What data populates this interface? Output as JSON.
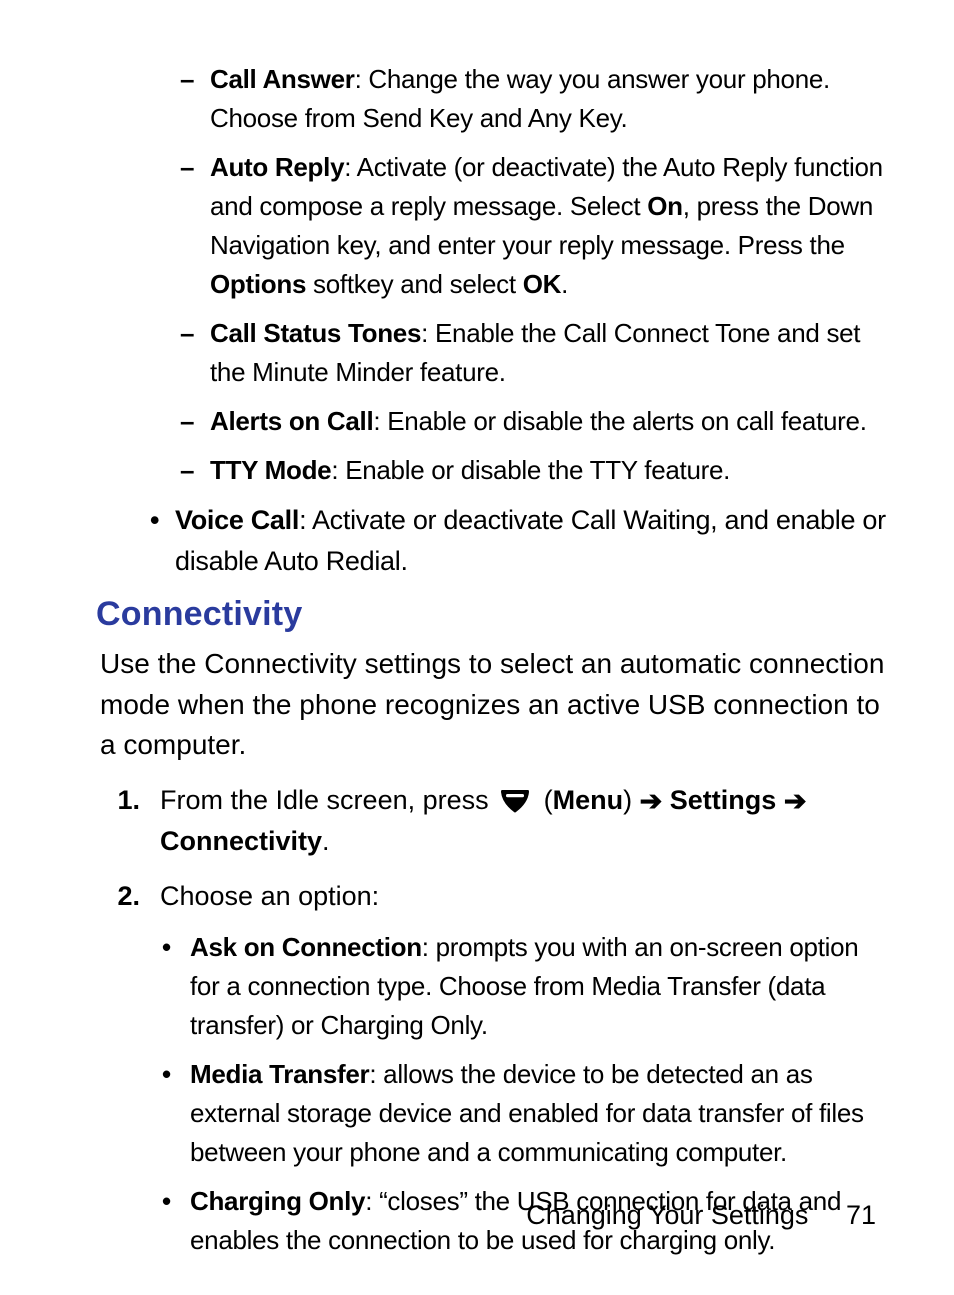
{
  "dashItems": [
    {
      "label": "Call Answer",
      "rest": ": Change the way you answer your phone. Choose from Send Key and Any Key."
    },
    {
      "label": "Auto Reply",
      "segments": [
        {
          "t": ": Activate (or deactivate) the Auto Reply function and compose a reply message. Select "
        },
        {
          "t": "On",
          "b": true
        },
        {
          "t": ", press the Down Navigation key, and enter your reply message. Press the "
        },
        {
          "t": "Options",
          "b": true
        },
        {
          "t": " softkey and select "
        },
        {
          "t": "OK",
          "b": true
        },
        {
          "t": "."
        }
      ]
    },
    {
      "label": "Call Status Tones",
      "rest": ": Enable the Call Connect Tone and set the Minute Minder feature."
    },
    {
      "label": "Alerts on Call",
      "rest": ": Enable or disable the alerts on call feature."
    },
    {
      "label": "TTY Mode",
      "rest": ": Enable or disable the TTY feature."
    }
  ],
  "voiceCall": {
    "label": "Voice Call",
    "rest": ": Activate or deactivate Call Waiting, and enable or disable Auto Redial."
  },
  "heading": "Connectivity",
  "intro": "Use the Connectivity settings to select an automatic connection mode when the phone recognizes an active USB connection to a computer.",
  "step1_pre": "From the Idle screen, press ",
  "step1_post_open": " (",
  "step1_menuWord": "Menu",
  "step1_afterMenu": ") ",
  "step1_settings": "Settings",
  "step1_connectivity": "Connectivity",
  "step1_period": ".",
  "arrowGlyph": "➔",
  "iconName": "menu-key-icon",
  "step2_lead": "Choose an option:",
  "options": [
    {
      "label": "Ask on Connection",
      "rest": ": prompts you with an on-screen option for a connection type. Choose from Media Transfer (data transfer) or Charging Only."
    },
    {
      "label": "Media Transfer",
      "rest": ": allows the device to be detected an as external storage device and enabled for data transfer of files between your phone and a communicating computer."
    },
    {
      "label": "Charging Only",
      "rest": ": “closes” the USB connection for data and enables the connection to be used for charging only."
    }
  ],
  "footer": {
    "chapter": "Changing Your Settings",
    "pageNum": "71"
  }
}
